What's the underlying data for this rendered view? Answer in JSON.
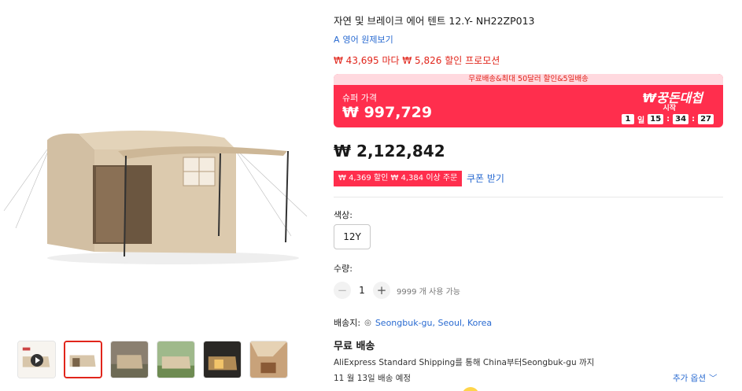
{
  "product": {
    "title": "자연 및 브레이크 에어 텐트 12.Y- NH22ZP013",
    "translate_label": "영어 원제보기",
    "translate_icon": "A",
    "promo_line": "₩ 43,695 마다 ₩ 5,826 할인 프로모션"
  },
  "super_deal": {
    "banner": "무료배송&최대 50달러 할인&5일배송",
    "label": "슈퍼 가격",
    "price": "₩ 997,729",
    "brand": "₩꿍돈대첩",
    "start": "시작",
    "countdown": {
      "days": "1",
      "day_unit": "일",
      "hours": "15",
      "minutes": "34",
      "seconds": "27",
      "sep": ":"
    }
  },
  "price": "₩ 2,122,842",
  "coupon": {
    "tag": "₩ 4,369 할인 ₩ 4,384 이상 주문",
    "link": "쿠폰 받기"
  },
  "color": {
    "label": "색상:",
    "selected": "12Y"
  },
  "quantity": {
    "label": "수량:",
    "minus": "−",
    "value": "1",
    "plus": "+",
    "available": "9999 개 사용 가능"
  },
  "shipping": {
    "label": "배송지:",
    "location": "Seongbuk-gu, Seoul, Korea",
    "free_title": "무료 배송",
    "description": "AliExpress Standard Shipping를 통해 China부터Seongbuk-gu 까지",
    "date": "11 월 13일 배송 예정",
    "more": "추가 옵션",
    "more_icon": "﹀"
  },
  "colors": {
    "accent_red": "#ff2e4d",
    "link_blue": "#2a6bd1",
    "price_red": "#e1251b"
  }
}
